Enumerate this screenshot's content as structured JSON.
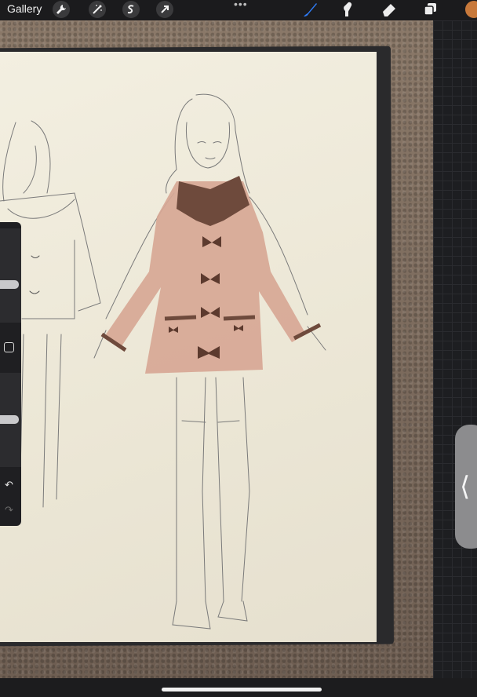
{
  "app": {
    "gallery_label": "Gallery"
  },
  "toolbar": {
    "left_tools": [
      {
        "name": "wrench-icon",
        "glyph": "✎"
      },
      {
        "name": "magic-wand-icon",
        "glyph": "✦"
      },
      {
        "name": "selection-icon",
        "glyph": "S"
      },
      {
        "name": "transform-arrow-icon",
        "glyph": "➚"
      }
    ],
    "more_label": "•••",
    "right_tools": [
      {
        "name": "brush-icon",
        "active": true
      },
      {
        "name": "smudge-icon"
      },
      {
        "name": "eraser-icon"
      },
      {
        "name": "layers-icon"
      }
    ],
    "current_color": "#c8793b"
  },
  "sidebar": {
    "brush_size_level": 0.2,
    "opacity_level": 0.3,
    "undo_glyph": "↶",
    "redo_glyph": "↷"
  },
  "side_tab": {
    "glyph": "⟨"
  },
  "colors": {
    "accent": "#2f7bf5",
    "toolbar_bg": "#1b1b1d",
    "coat": "#d7a795",
    "collar": "#6e4a3c",
    "bows": "#5c3a2e"
  }
}
